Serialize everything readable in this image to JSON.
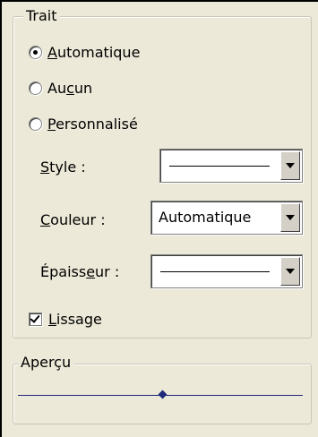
{
  "trait_group": {
    "title": "Trait",
    "radios": [
      {
        "label_start": "",
        "label_underlined": "A",
        "label_end": "utomatique",
        "selected": true
      },
      {
        "label_start": "Au",
        "label_underlined": "c",
        "label_end": "un",
        "selected": false
      },
      {
        "label_start": "",
        "label_underlined": "P",
        "label_end": "ersonnalisé",
        "selected": false
      }
    ],
    "style": {
      "label_underlined": "S",
      "label_end": "tyle :",
      "value": ""
    },
    "couleur": {
      "label_underlined": "C",
      "label_end": "ouleur :",
      "value": "Automatique"
    },
    "epaisseur": {
      "label_start": "Épaiss",
      "label_underlined": "e",
      "label_end": "ur :",
      "value": ""
    },
    "lissage": {
      "label_underlined": "L",
      "label_end": "issage",
      "checked": true
    }
  },
  "apercu_group": {
    "title": "Aperçu",
    "line_color": "#1f2a7a"
  }
}
